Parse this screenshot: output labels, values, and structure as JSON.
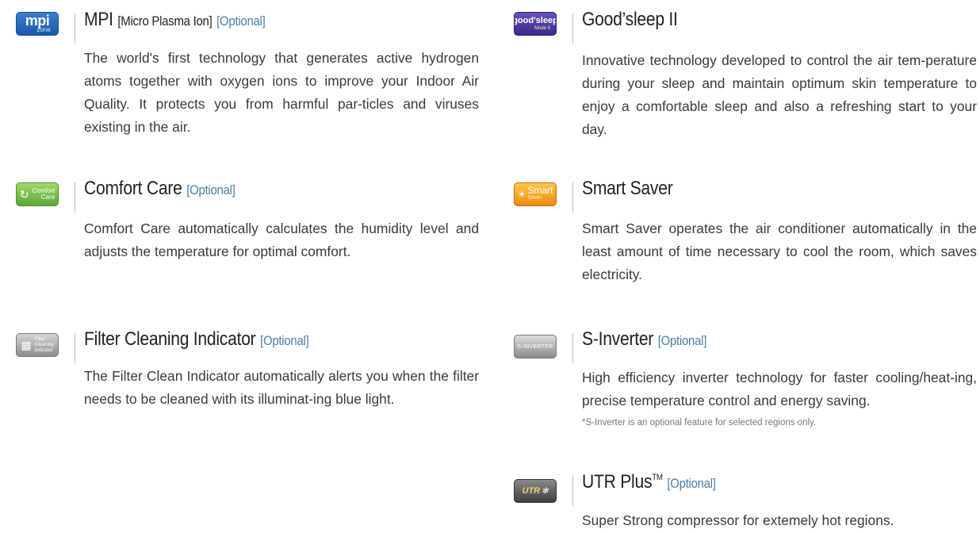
{
  "features": {
    "mpi": {
      "logo": {
        "main": "mpi",
        "sub": "zone"
      },
      "title": "MPI",
      "subtitle": "[Micro Plasma Ion]",
      "optional": "[Optional]",
      "description": "The world's first technology that generates active hydrogen atoms together with oxygen ions to improve your Indoor Air Quality. It protects you from harmful par-ticles and viruses existing in the air."
    },
    "goodsleep": {
      "logo": {
        "main": "good'sleep",
        "sub": "Mode II"
      },
      "title": "Good’sleep II",
      "description": "Innovative technology developed to control the air tem-perature during your sleep and maintain optimum skin temperature to enjoy a comfortable sleep and also a refreshing start to your day."
    },
    "comfort": {
      "logo": {
        "line1": "Comfort",
        "line2": "Care"
      },
      "title": "Comfort Care",
      "optional": "[Optional]",
      "description": "Comfort Care automatically calculates the humidity level and adjusts the temperature for optimal comfort."
    },
    "smartsaver": {
      "logo": {
        "line1": "Smart",
        "line2": "Saver"
      },
      "title": "Smart Saver",
      "description": "Smart Saver operates the air conditioner automatically in the least amount of time necessary to cool the room, which saves electricity."
    },
    "filter": {
      "logo": {
        "line1": "Filter",
        "line2": "Cleaning",
        "line3": "indicator"
      },
      "title": "Filter Cleaning Indicator",
      "optional": "[Optional]",
      "description": "The Filter Clean Indicator automatically alerts you when the filter needs to be cleaned with its illuminat-ing blue light."
    },
    "sinverter": {
      "logo": {
        "text": "S·INVERTER"
      },
      "title": "S-Inverter",
      "optional": "[Optional]",
      "description": "High efficiency inverter technology for faster cooling/heat-ing, precise temperature control and energy saving.",
      "note": "*S-Inverter is an optional feature for selected regions only."
    },
    "utr": {
      "logo": {
        "text": "UTR"
      },
      "title": "UTR Plus",
      "trademark": "TM",
      "optional": "[Optional]",
      "description": "Super Strong compressor for extemely hot regions."
    }
  }
}
